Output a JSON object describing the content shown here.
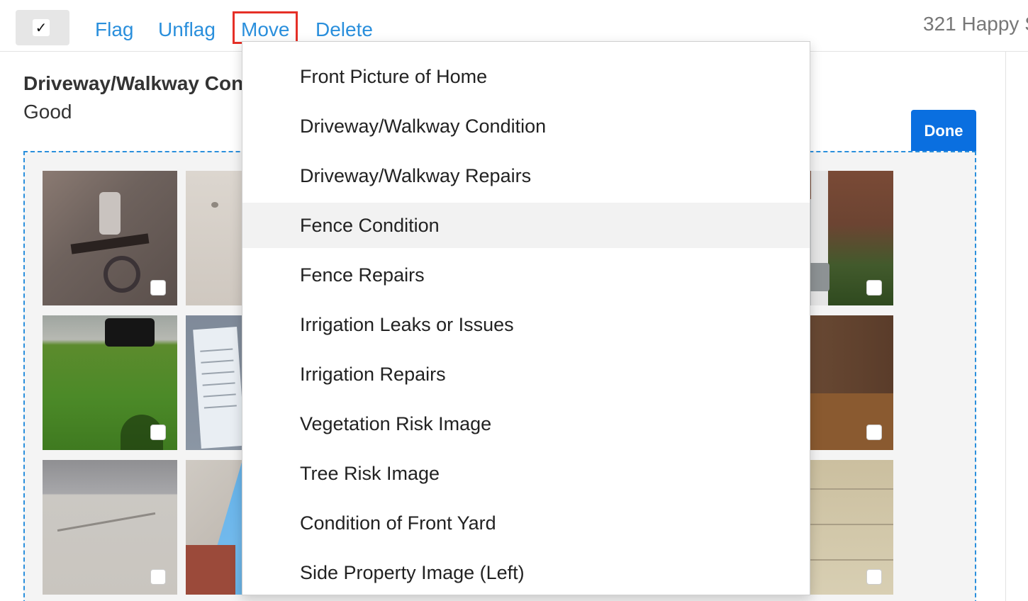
{
  "toolbar": {
    "select_all_glyph": "✓",
    "flag_label": "Flag",
    "unflag_label": "Unflag",
    "move_label": "Move",
    "delete_label": "Delete",
    "address": "321 Happy S"
  },
  "section": {
    "title": "Driveway/Walkway Con",
    "value": "Good",
    "done_label": "Done"
  },
  "move_menu": {
    "items": [
      "Front Picture of Home",
      "Driveway/Walkway Condition",
      "Driveway/Walkway Repairs",
      "Fence Condition",
      "Fence Repairs",
      "Irrigation Leaks or Issues",
      "Irrigation Repairs",
      "Vegetation Risk Image",
      "Tree Risk Image",
      "Condition of Front Yard",
      "Side Property Image (Left)"
    ],
    "hovered_item": "Fence Condition"
  },
  "colors": {
    "link": "#2a8fdc",
    "move_highlight": "#e53027",
    "done_button": "#0a6fe0",
    "dropzone_border": "#2a8fdc"
  }
}
